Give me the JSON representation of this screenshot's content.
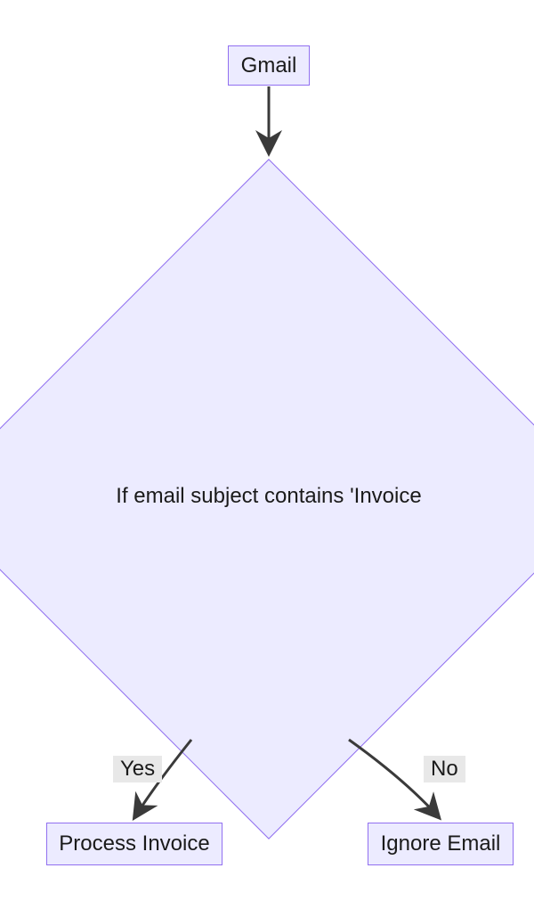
{
  "nodes": {
    "gmail": {
      "label": "Gmail"
    },
    "condition": {
      "label": "If email subject contains 'Invoice"
    },
    "process": {
      "label": "Process Invoice"
    },
    "ignore": {
      "label": "Ignore Email"
    }
  },
  "edges": {
    "yes": {
      "label": "Yes"
    },
    "no": {
      "label": "No"
    }
  },
  "colors": {
    "nodeFill": "#ecebff",
    "nodeStroke": "#9170f0",
    "edgeStroke": "#3a3a3a",
    "edgeLabelBg": "#e8e8e8"
  }
}
